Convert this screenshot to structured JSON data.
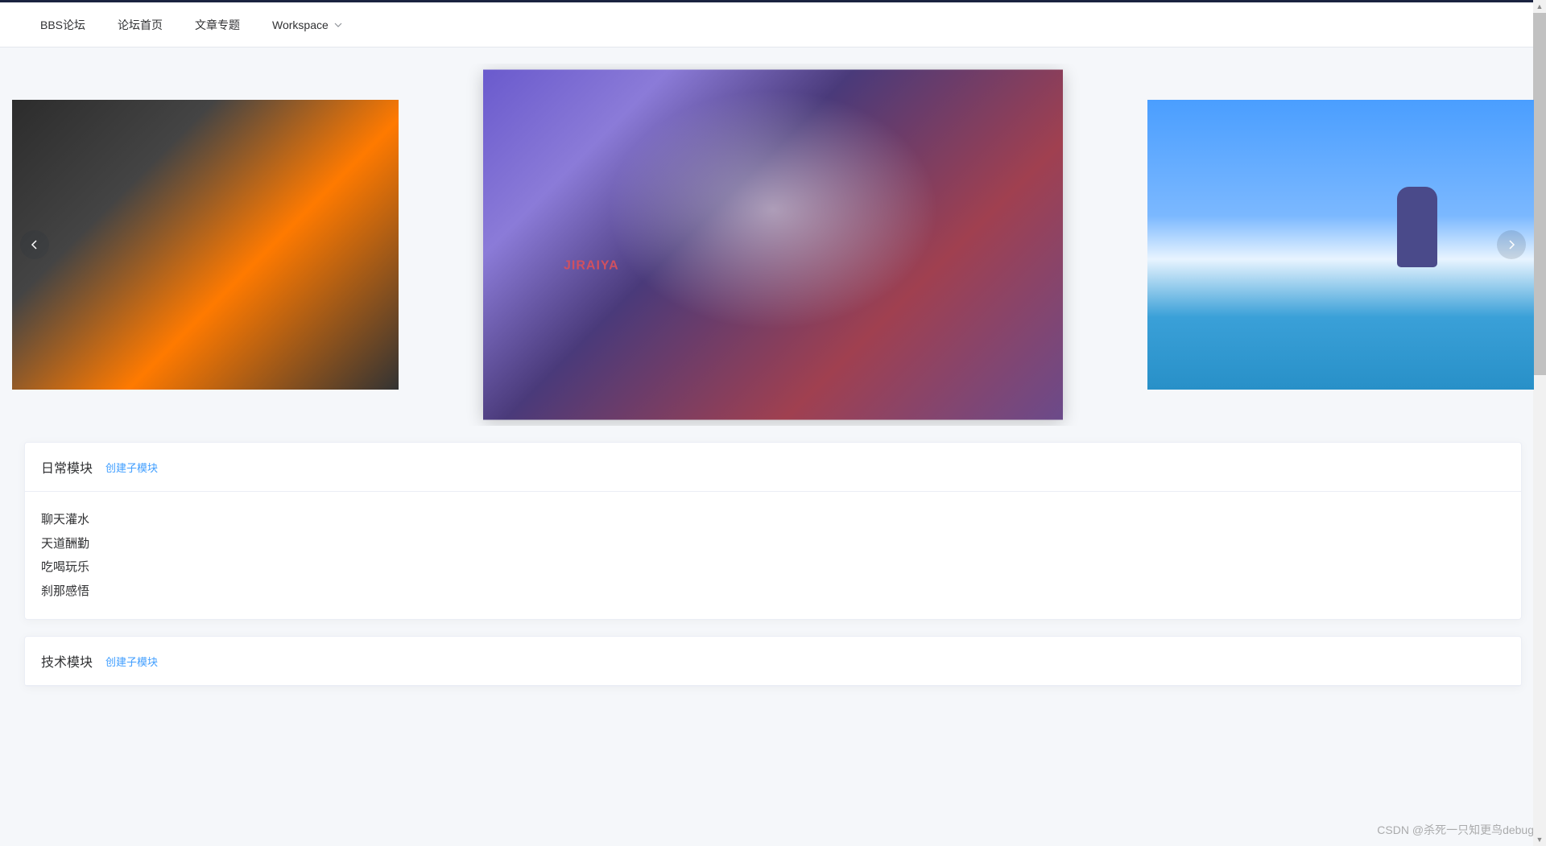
{
  "nav": {
    "items": [
      {
        "label": "BBS论坛"
      },
      {
        "label": "论坛首页"
      },
      {
        "label": "文章专题"
      },
      {
        "label": "Workspace",
        "has_dropdown": true
      }
    ]
  },
  "carousel": {
    "slides": [
      {
        "alt": "anime-group-image"
      },
      {
        "alt": "anime-character-image",
        "label": "JIRAIYA"
      },
      {
        "alt": "anime-beach-image"
      }
    ]
  },
  "modules": [
    {
      "title": "日常模块",
      "create_link": "创建子模块",
      "items": [
        "聊天灌水",
        "天道酬勤",
        "吃喝玩乐",
        "刹那感悟"
      ]
    },
    {
      "title": "技术模块",
      "create_link": "创建子模块",
      "items": []
    }
  ],
  "watermark": "CSDN @杀死一只知更鸟debug"
}
